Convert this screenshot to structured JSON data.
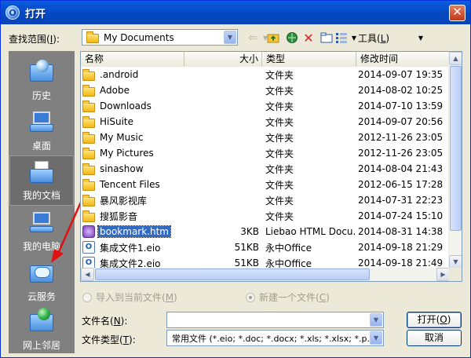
{
  "window": {
    "title": "打开"
  },
  "look_in": {
    "label": "查找范围(",
    "label_key": "I",
    "label_end": "):",
    "value": "My Documents"
  },
  "toolbar": {
    "tools_label": "工具(",
    "tools_key": "L",
    "tools_end": ")"
  },
  "places": [
    {
      "label": "历史",
      "icon": "history-icon"
    },
    {
      "label": "桌面",
      "icon": "desktop-icon"
    },
    {
      "label": "我的文档",
      "icon": "my-documents-icon"
    },
    {
      "label": "我的电脑",
      "icon": "my-computer-icon"
    },
    {
      "label": "云服务",
      "icon": "cloud-service-icon"
    },
    {
      "label": "网上邻居",
      "icon": "network-places-icon"
    }
  ],
  "columns": {
    "name": "名称",
    "size": "大小",
    "type": "类型",
    "date": "修改时间"
  },
  "files": [
    {
      "name": ".android",
      "size": "",
      "type": "文件夹",
      "date": "2014-09-07 19:35",
      "kind": "folder"
    },
    {
      "name": "Adobe",
      "size": "",
      "type": "文件夹",
      "date": "2014-08-02 10:25",
      "kind": "folder"
    },
    {
      "name": "Downloads",
      "size": "",
      "type": "文件夹",
      "date": "2014-07-10 13:59",
      "kind": "folder"
    },
    {
      "name": "HiSuite",
      "size": "",
      "type": "文件夹",
      "date": "2014-09-07 20:56",
      "kind": "folder"
    },
    {
      "name": "My Music",
      "size": "",
      "type": "文件夹",
      "date": "2012-11-26 23:05",
      "kind": "folder"
    },
    {
      "name": "My Pictures",
      "size": "",
      "type": "文件夹",
      "date": "2012-11-26 23:05",
      "kind": "folder"
    },
    {
      "name": "sinashow",
      "size": "",
      "type": "文件夹",
      "date": "2014-08-04 21:43",
      "kind": "folder"
    },
    {
      "name": "Tencent Files",
      "size": "",
      "type": "文件夹",
      "date": "2012-06-15 17:28",
      "kind": "folder"
    },
    {
      "name": "暴风影视库",
      "size": "",
      "type": "文件夹",
      "date": "2014-07-31 22:23",
      "kind": "folder"
    },
    {
      "name": "搜狐影音",
      "size": "",
      "type": "文件夹",
      "date": "2014-07-24 15:10",
      "kind": "folder"
    },
    {
      "name": "bookmark.htm",
      "size": "3KB",
      "type": "Liebao HTML Docu...",
      "date": "2014-08-31 14:38",
      "kind": "htm",
      "selected": true
    },
    {
      "name": "集成文件1.eio",
      "size": "51KB",
      "type": "永中Office",
      "date": "2014-09-18 21:29",
      "kind": "eio"
    },
    {
      "name": "集成文件2.eio",
      "size": "51KB",
      "type": "永中Office",
      "date": "2014-09-18 21:49",
      "kind": "eio"
    }
  ],
  "radios": {
    "import": "导入到当前文件(",
    "import_key": "M",
    "import_end": ")",
    "new": "新建一个文件(",
    "new_key": "C",
    "new_end": ")"
  },
  "filename": {
    "label": "文件名(",
    "key": "N",
    "end": "):",
    "value": ""
  },
  "filetype": {
    "label": "文件类型(",
    "key": "T",
    "end": "):",
    "value": "常用文件 (*.eio; *.doc; *.docx; *.xls; *.xlsx; *.p..."
  },
  "buttons": {
    "open": "打开(",
    "open_key": "O",
    "open_end": ")",
    "cancel": "取消"
  }
}
